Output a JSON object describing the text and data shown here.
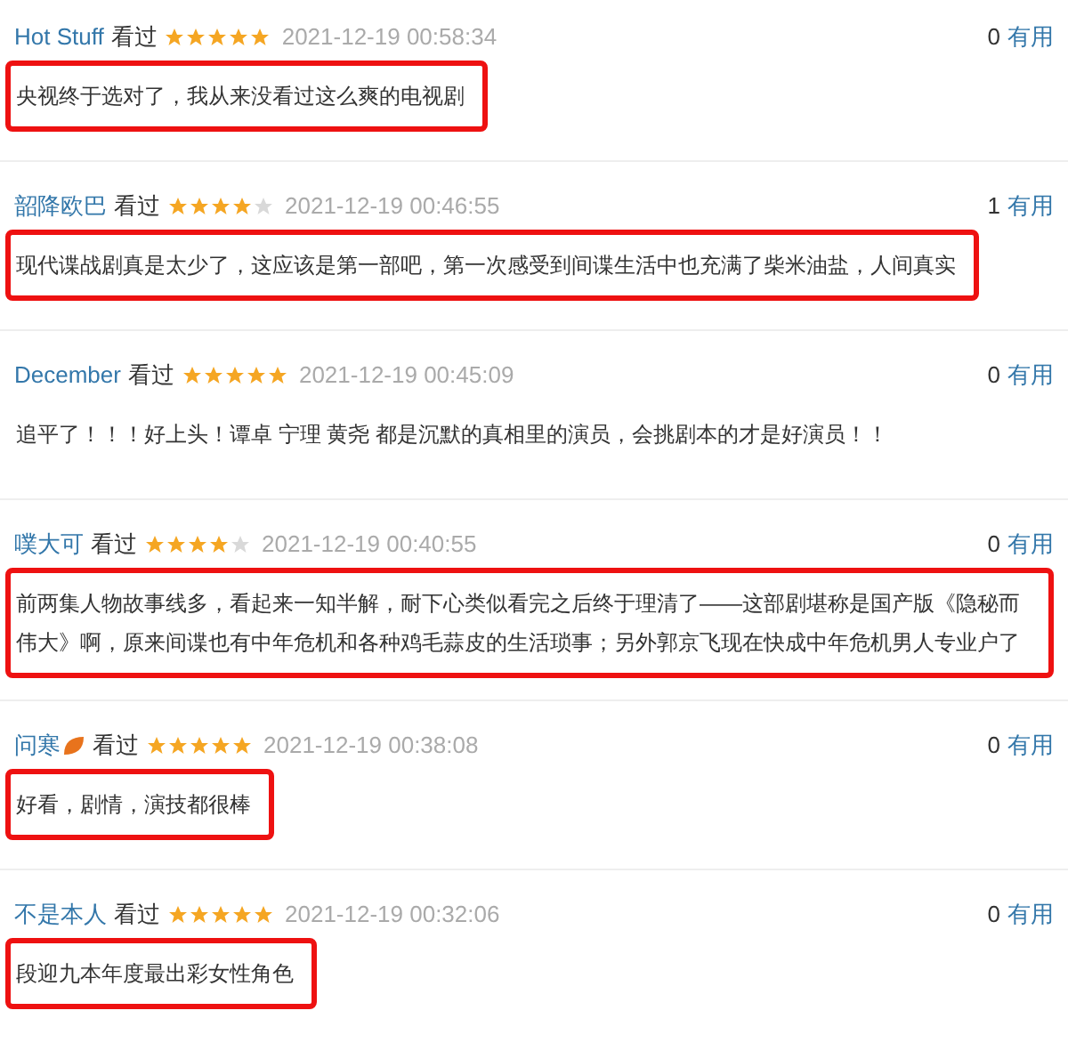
{
  "comments": [
    {
      "user": "Hot Stuff",
      "status": "看过",
      "stars": 5,
      "time": "2021-12-19 00:58:34",
      "votes": "0",
      "vote_label": "有用",
      "text": "央视终于选对了，我从来没看过这么爽的电视剧",
      "highlighted": true
    },
    {
      "user": "韶降欧巴",
      "status": "看过",
      "stars": 4,
      "time": "2021-12-19 00:46:55",
      "votes": "1",
      "vote_label": "有用",
      "text": "现代谍战剧真是太少了，这应该是第一部吧，第一次感受到间谍生活中也充满了柴米油盐，人间真实",
      "highlighted": true
    },
    {
      "user": "December",
      "status": "看过",
      "stars": 5,
      "time": "2021-12-19 00:45:09",
      "votes": "0",
      "vote_label": "有用",
      "text": "追平了！！！好上头！谭卓 宁理 黄尧 都是沉默的真相里的演员，会挑剧本的才是好演员！！",
      "highlighted": false
    },
    {
      "user": "噗大可",
      "status": "看过",
      "stars": 4,
      "time": "2021-12-19 00:40:55",
      "votes": "0",
      "vote_label": "有用",
      "text": "前两集人物故事线多，看起来一知半解，耐下心类似看完之后终于理清了——这部剧堪称是国产版《隐秘而伟大》啊，原来间谍也有中年危机和各种鸡毛蒜皮的生活琐事；另外郭京飞现在快成中年危机男人专业户了",
      "highlighted": true
    },
    {
      "user": "问寒",
      "leaf_icon": true,
      "status": "看过",
      "stars": 5,
      "time": "2021-12-19 00:38:08",
      "votes": "0",
      "vote_label": "有用",
      "text": "好看，剧情，演技都很棒",
      "highlighted": true
    },
    {
      "user": "不是本人",
      "status": "看过",
      "stars": 5,
      "time": "2021-12-19 00:32:06",
      "votes": "0",
      "vote_label": "有用",
      "text": "段迎九本年度最出彩女性角色",
      "highlighted": true
    }
  ]
}
